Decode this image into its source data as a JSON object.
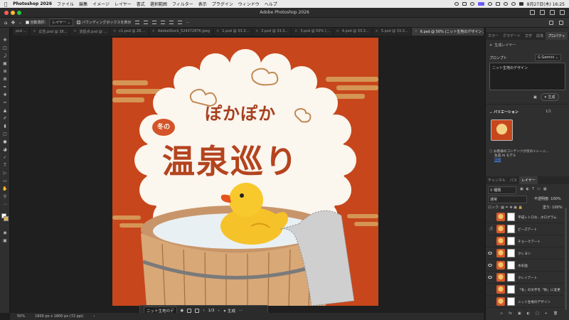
{
  "menubar": {
    "app": "Photoshop 2026",
    "items": [
      "ファイル",
      "編集",
      "イメージ",
      "レイヤー",
      "書式",
      "選択範囲",
      "フィルター",
      "表示",
      "プラグイン",
      "ウィンドウ",
      "ヘルプ"
    ],
    "datetime": "8月27日(木) 16:25"
  },
  "window": {
    "title": "Adobe Photoshop 2026"
  },
  "options": {
    "auto_select": "自動選択:",
    "target": "レイヤー",
    "bounding_box": "バウンディングボックスを表示"
  },
  "tabs": [
    {
      "label": "psd ..."
    },
    {
      "label": "広告.psd @ 38..."
    },
    {
      "label": "流星点.psd @ ..."
    },
    {
      "label": "c1.psd @ 26...."
    },
    {
      "label": "AdobeStock_524372876.jpeg"
    },
    {
      "label": "1.psd @ 33.3..."
    },
    {
      "label": "2.psd @ 33.3..."
    },
    {
      "label": "3.psd @ 50% (..."
    },
    {
      "label": "4.psd @ 33.3..."
    },
    {
      "label": "5.psd @ 33.3..."
    },
    {
      "label": "6.psd @ 50% (ニット生地のデザイン 2, RGB/8) *"
    }
  ],
  "artwork": {
    "line1": "ぽかぽか",
    "badge": "冬の",
    "title": "温泉巡り"
  },
  "taskbar": {
    "field": "ニット生地のデ",
    "pager": "1/3",
    "generate": "生成"
  },
  "status": {
    "zoom": "50%",
    "size": "1800 px x 1800 px (72 ppi)"
  },
  "panel_tabs": {
    "color": "カラー",
    "gradient": "グラデート",
    "type": "文字",
    "history": "段落",
    "properties": "プロパティ"
  },
  "properties": {
    "header": "生成レイヤー",
    "prompt_label": "プロンプト",
    "model": "Gemini",
    "prompt_value": "ニット生地のデザイン",
    "generate_button": "生成",
    "variations_label": "バリエーション",
    "variations_count": "1/1",
    "notice": "お客様のコンテンツが次のトレーニ...",
    "notice2": "生成 AI モデル",
    "notice_link": "詳細"
  },
  "layers_panel": {
    "tabs": {
      "channels": "チャンネル",
      "paths": "パス",
      "layers": "レイヤー"
    },
    "filter": "種類",
    "blend": "通常",
    "opacity_label": "不透明度:",
    "opacity": "100%",
    "lock_label": "ロック:",
    "fill_label": "塗り:",
    "fill": "100%",
    "layers": [
      {
        "name": "平成レトロな...ホログラム"
      },
      {
        "name": "ビーズアート"
      },
      {
        "name": "チョークアート"
      },
      {
        "name": "クレヨン"
      },
      {
        "name": "水彩画"
      },
      {
        "name": "クレイアート"
      },
      {
        "name": "「冬」の文字を「秋」に変更"
      },
      {
        "name": "ニット生地のデザイン"
      }
    ]
  },
  "colors": {
    "accent": "#c8461c",
    "cream": "#fbf6ee",
    "text_brown": "#a5401f",
    "gold": "#e0b46a"
  }
}
